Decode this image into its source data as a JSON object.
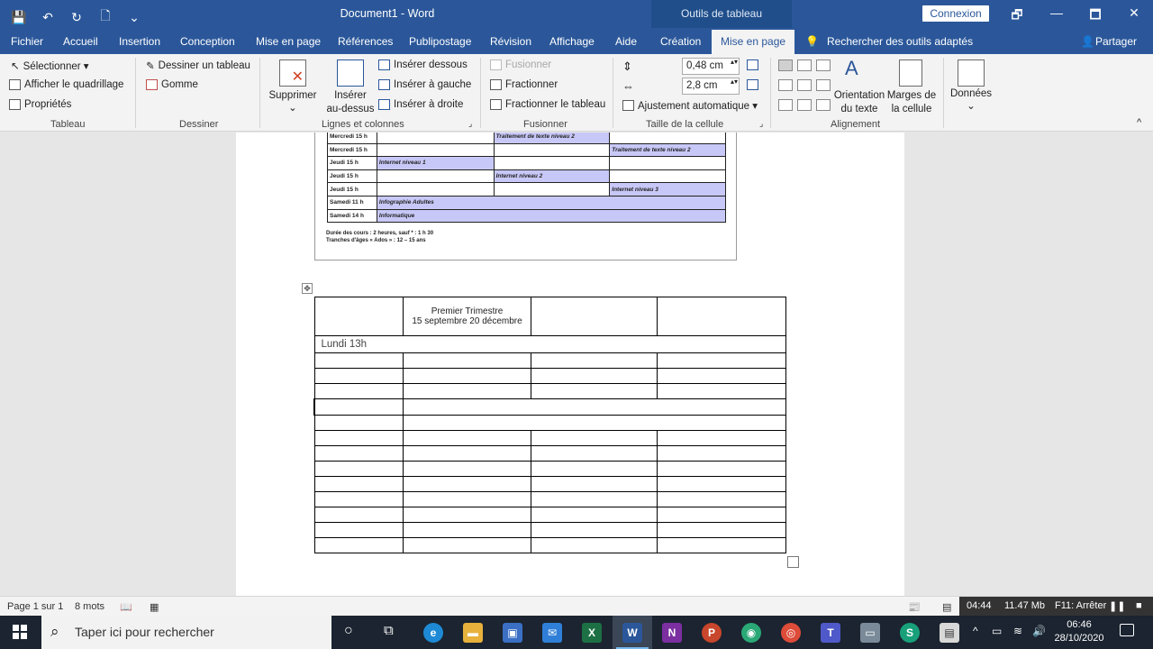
{
  "titlebar": {
    "title": "Document1  -  Word",
    "context_header": "Outils de tableau",
    "connexion": "Connexion",
    "qat": [
      "💾",
      "↶",
      "↻",
      "🗋",
      "⌄"
    ],
    "win": [
      "🗗",
      "🗖",
      "✕"
    ]
  },
  "tabs": {
    "fichier": "Fichier",
    "accueil": "Accueil",
    "insertion": "Insertion",
    "conception": "Conception",
    "mise_en_page": "Mise en page",
    "references": "Références",
    "publipostage": "Publipostage",
    "revision": "Révision",
    "affichage": "Affichage",
    "aide": "Aide",
    "creation": "Création",
    "mise_en_page_ctx": "Mise en page",
    "tell_me": "Rechercher des outils adaptés",
    "partager": "Partager"
  },
  "ribbon": {
    "tableau": {
      "selectionner": "Sélectionner ▾",
      "quadrillage": "Afficher le quadrillage",
      "proprietes": "Propriétés",
      "label": "Tableau"
    },
    "dessiner": {
      "dessiner_tableau": "Dessiner un tableau",
      "gomme": "Gomme",
      "label": "Dessiner"
    },
    "lignes": {
      "supprimer": "Supprimer",
      "inserer_dessus_1": "Insérer",
      "inserer_dessus_2": "au-dessus",
      "inserer_dessous": "Insérer dessous",
      "inserer_gauche": "Insérer à gauche",
      "inserer_droite": "Insérer à droite",
      "label": "Lignes et colonnes"
    },
    "fusionner": {
      "fusionner": "Fusionner",
      "fractionner": "Fractionner",
      "fractionner_tableau": "Fractionner le tableau",
      "label": "Fusionner"
    },
    "taille": {
      "hauteur": "0,48 cm",
      "largeur": "2,8 cm",
      "ajustement": "Ajustement automatique ▾",
      "label": "Taille de la cellule"
    },
    "alignement": {
      "orientation_1": "Orientation",
      "orientation_2": "du texte",
      "marges_1": "Marges de",
      "marges_2": "la cellule",
      "label": "Alignement"
    },
    "donnees": {
      "label": "Données"
    }
  },
  "old_table": {
    "rows": [
      [
        "Mercredi 15 h",
        "",
        "Traitement de texte niveau 2",
        ""
      ],
      [
        "Mercredi 15 h",
        "",
        "",
        "Traitement de texte niveau 2"
      ],
      [
        "Jeudi 15 h",
        "Internet niveau 1",
        "",
        ""
      ],
      [
        "Jeudi 15 h",
        "",
        "Internet niveau 2",
        ""
      ],
      [
        "Jeudi 15 h",
        "",
        "",
        "Internet niveau 3"
      ]
    ],
    "full_rows": [
      [
        "Samedi 11 h",
        "Infographie Adultes"
      ],
      [
        "Samedi 14 h",
        "Informatique"
      ]
    ],
    "note_1": "Durée des cours : 2 heures, sauf * : 1 h 30",
    "note_2": "Tranches d'âges « Ados » : 12 – 15 ans"
  },
  "new_table": {
    "header_line1": "Premier Trimestre",
    "header_line2": "15 septembre 20 décembre",
    "lundi": "Lundi 13h"
  },
  "statusbar": {
    "page": "Page 1 sur 1",
    "words": "8 mots",
    "overlay_time": "04:44",
    "overlay_size": "11.47 Mb",
    "overlay_key": "F11: Arrêter"
  },
  "taskbar": {
    "search_placeholder": "Taper ici pour rechercher",
    "time": "06:46",
    "date": "28/10/2020"
  },
  "colors": {
    "word_blue": "#2b579a",
    "highlight_cell": "#c8c8f8"
  }
}
